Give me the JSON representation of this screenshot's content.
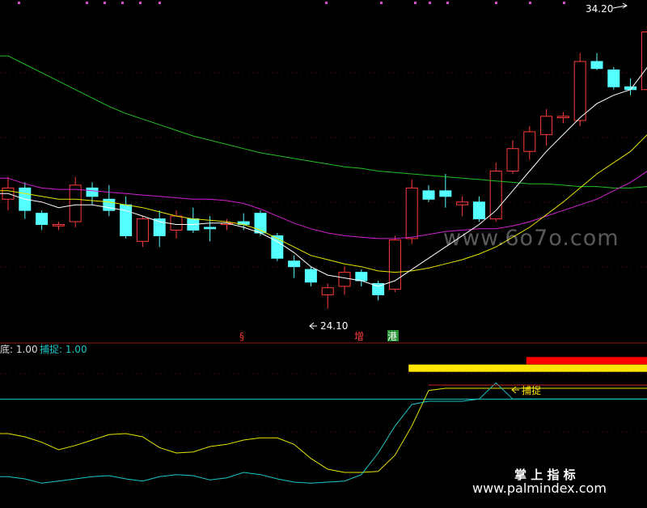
{
  "main_panel": {
    "price_high_label": "34.20",
    "price_low_label": "24.10",
    "signal_markers": [
      {
        "text": "§",
        "color": "#ff3333"
      },
      {
        "text": "增",
        "color": "#ffffff",
        "bg": "#cc0000"
      },
      {
        "text": "港",
        "color": "#ffffff",
        "bg": "#1f8f2f"
      }
    ],
    "watermark": "www.6o7o.com"
  },
  "indicator_panel": {
    "legend_prefix": "底: 1.00",
    "legend_capture": "捕捉: 1.00",
    "capture_label": "捕捉",
    "watermark_cn": "掌 上 指 标",
    "watermark_url": "www.palmindex.com"
  },
  "chart_data": [
    {
      "type": "candlestick",
      "ylim": [
        23.0,
        34.8
      ],
      "candles": [
        {
          "o": 28.0,
          "h": 28.8,
          "l": 27.6,
          "c": 28.4
        },
        {
          "o": 28.4,
          "h": 28.6,
          "l": 27.3,
          "c": 27.6
        },
        {
          "o": 27.5,
          "h": 27.6,
          "l": 26.9,
          "c": 27.1
        },
        {
          "o": 27.05,
          "h": 27.2,
          "l": 26.9,
          "c": 27.1
        },
        {
          "o": 27.2,
          "h": 28.8,
          "l": 27.0,
          "c": 28.5
        },
        {
          "o": 28.4,
          "h": 28.6,
          "l": 27.8,
          "c": 28.1
        },
        {
          "o": 28.0,
          "h": 28.5,
          "l": 27.4,
          "c": 27.6
        },
        {
          "o": 27.8,
          "h": 28.1,
          "l": 26.6,
          "c": 26.7
        },
        {
          "o": 26.5,
          "h": 27.4,
          "l": 26.3,
          "c": 27.3
        },
        {
          "o": 27.3,
          "h": 27.6,
          "l": 26.3,
          "c": 26.7
        },
        {
          "o": 26.9,
          "h": 27.6,
          "l": 26.6,
          "c": 27.4
        },
        {
          "o": 27.3,
          "h": 27.7,
          "l": 26.8,
          "c": 26.9
        },
        {
          "o": 27.0,
          "h": 27.4,
          "l": 26.5,
          "c": 26.95
        },
        {
          "o": 27.1,
          "h": 27.3,
          "l": 26.9,
          "c": 27.15
        },
        {
          "o": 27.2,
          "h": 27.5,
          "l": 26.9,
          "c": 27.1
        },
        {
          "o": 27.5,
          "h": 27.6,
          "l": 26.7,
          "c": 26.8
        },
        {
          "o": 26.7,
          "h": 26.8,
          "l": 25.8,
          "c": 25.9
        },
        {
          "o": 25.8,
          "h": 26.0,
          "l": 25.2,
          "c": 25.6
        },
        {
          "o": 25.5,
          "h": 25.6,
          "l": 24.9,
          "c": 25.05
        },
        {
          "o": 24.6,
          "h": 25.0,
          "l": 24.1,
          "c": 24.85
        },
        {
          "o": 24.9,
          "h": 25.6,
          "l": 24.6,
          "c": 25.4
        },
        {
          "o": 25.4,
          "h": 25.5,
          "l": 24.9,
          "c": 25.1
        },
        {
          "o": 25.0,
          "h": 25.1,
          "l": 24.4,
          "c": 24.6
        },
        {
          "o": 24.8,
          "h": 26.7,
          "l": 24.7,
          "c": 26.55
        },
        {
          "o": 26.6,
          "h": 28.7,
          "l": 26.4,
          "c": 28.4
        },
        {
          "o": 28.3,
          "h": 28.5,
          "l": 27.9,
          "c": 28.0
        },
        {
          "o": 28.3,
          "h": 28.9,
          "l": 27.7,
          "c": 28.1
        },
        {
          "o": 27.8,
          "h": 28.1,
          "l": 27.4,
          "c": 27.9
        },
        {
          "o": 27.9,
          "h": 28.1,
          "l": 27.2,
          "c": 27.3
        },
        {
          "o": 27.3,
          "h": 29.3,
          "l": 27.2,
          "c": 29.0
        },
        {
          "o": 29.0,
          "h": 30.1,
          "l": 28.9,
          "c": 29.8
        },
        {
          "o": 29.7,
          "h": 30.6,
          "l": 29.4,
          "c": 30.4
        },
        {
          "o": 30.3,
          "h": 31.2,
          "l": 29.9,
          "c": 30.95
        },
        {
          "o": 30.9,
          "h": 31.1,
          "l": 30.7,
          "c": 30.95
        },
        {
          "o": 30.8,
          "h": 33.2,
          "l": 30.6,
          "c": 32.9
        },
        {
          "o": 32.9,
          "h": 33.2,
          "l": 32.6,
          "c": 32.65
        },
        {
          "o": 32.6,
          "h": 32.7,
          "l": 31.9,
          "c": 32.0
        },
        {
          "o": 32.0,
          "h": 32.3,
          "l": 31.7,
          "c": 31.9
        },
        {
          "o": 31.9,
          "h": 34.2,
          "l": 31.8,
          "c": 33.95
        }
      ],
      "ma_white": [
        28.2,
        28.0,
        27.9,
        27.7,
        27.8,
        27.8,
        27.7,
        27.6,
        27.4,
        27.2,
        27.1,
        27.1,
        27.15,
        27.15,
        27.0,
        26.8,
        26.5,
        26.1,
        25.6,
        25.3,
        25.2,
        25.1,
        24.9,
        25.1,
        25.5,
        25.9,
        26.3,
        26.7,
        27.1,
        27.6,
        28.3,
        29.0,
        29.7,
        30.3,
        30.9,
        31.4,
        31.7,
        31.9,
        32.7
      ],
      "ma_yellow": [
        28.3,
        28.2,
        28.1,
        28.0,
        28.0,
        27.95,
        27.9,
        27.8,
        27.7,
        27.55,
        27.4,
        27.3,
        27.25,
        27.2,
        27.1,
        26.9,
        26.6,
        26.3,
        26.0,
        25.85,
        25.7,
        25.6,
        25.45,
        25.4,
        25.45,
        25.55,
        25.7,
        25.85,
        26.05,
        26.3,
        26.65,
        27.0,
        27.45,
        27.9,
        28.4,
        28.9,
        29.3,
        29.7,
        30.3
      ],
      "ma_magenta": [
        28.75,
        28.55,
        28.4,
        28.35,
        28.35,
        28.3,
        28.25,
        28.2,
        28.15,
        28.1,
        28.05,
        28.0,
        28.0,
        27.95,
        27.85,
        27.65,
        27.4,
        27.15,
        26.95,
        26.8,
        26.7,
        26.65,
        26.6,
        26.6,
        26.65,
        26.75,
        26.85,
        26.9,
        26.95,
        26.95,
        27.05,
        27.2,
        27.4,
        27.6,
        27.8,
        28.0,
        28.3,
        28.6,
        29.0
      ],
      "ma_green": [
        33.1,
        32.8,
        32.5,
        32.2,
        31.9,
        31.6,
        31.3,
        31.05,
        30.85,
        30.65,
        30.45,
        30.25,
        30.1,
        29.95,
        29.8,
        29.65,
        29.55,
        29.45,
        29.35,
        29.25,
        29.15,
        29.1,
        29.0,
        28.95,
        28.9,
        28.85,
        28.8,
        28.75,
        28.7,
        28.65,
        28.6,
        28.55,
        28.55,
        28.5,
        28.45,
        28.45,
        28.4,
        28.4,
        28.45
      ]
    },
    {
      "type": "line",
      "ylim": [
        0,
        1.2
      ],
      "series": [
        {
          "color": "#e6e600",
          "values": [
            0.48,
            0.45,
            0.4,
            0.33,
            0.37,
            0.42,
            0.47,
            0.48,
            0.45,
            0.35,
            0.3,
            0.31,
            0.36,
            0.38,
            0.42,
            0.44,
            0.44,
            0.38,
            0.25,
            0.15,
            0.12,
            0.12,
            0.13,
            0.28,
            0.55,
            0.88,
            0.9,
            0.9,
            0.9,
            0.9,
            0.9,
            0.9,
            0.9,
            0.9,
            0.9,
            0.9,
            0.9,
            0.9,
            0.9
          ]
        },
        {
          "color": "#19c8c8",
          "values": [
            0.08,
            0.06,
            0.02,
            0.04,
            0.06,
            0.08,
            0.09,
            0.06,
            0.04,
            0.08,
            0.1,
            0.09,
            0.05,
            0.07,
            0.12,
            0.1,
            0.06,
            0.03,
            0.02,
            0.03,
            0.04,
            0.1,
            0.3,
            0.55,
            0.75,
            0.78,
            0.78,
            0.78,
            0.8,
            0.95,
            0.8,
            0.8,
            0.8,
            0.8,
            0.8,
            0.8,
            0.8,
            0.8,
            0.8
          ]
        }
      ],
      "level": 0.8,
      "bars": [
        {
          "color": "#ffe600",
          "from": 24,
          "to": 38
        },
        {
          "color": "#ff0000",
          "from": 31,
          "to": 38
        }
      ]
    }
  ]
}
